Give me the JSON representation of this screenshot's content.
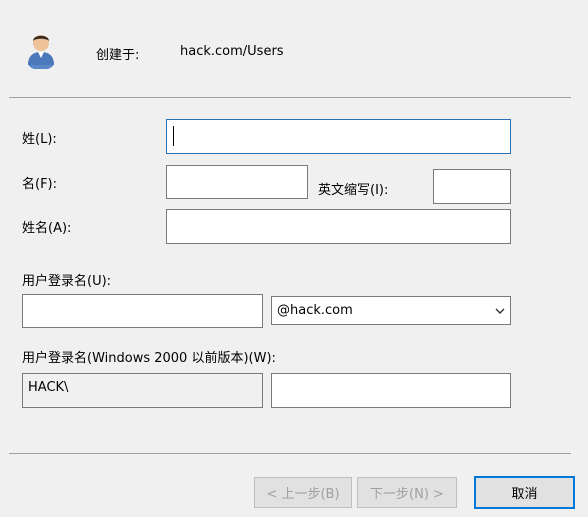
{
  "header": {
    "created_in_label": "创建于:",
    "created_in_value": "hack.com/Users"
  },
  "form": {
    "last_name_label": "姓(L):",
    "last_name_value": "",
    "first_name_label": "名(F):",
    "first_name_value": "",
    "initials_label": "英文缩写(I):",
    "initials_value": "",
    "full_name_label": "姓名(A):",
    "full_name_value": "",
    "logon_name_label": "用户登录名(U):",
    "logon_name_value": "",
    "domain_selected": "@hack.com",
    "prewin2000_label": "用户登录名(Windows 2000 以前版本)(W):",
    "prewin2000_domain": "HACK\\",
    "prewin2000_value": ""
  },
  "buttons": {
    "back_label": "< 上一步(B)",
    "next_label": "下一步(N) >",
    "cancel_label": "取消"
  },
  "icons": {
    "user": "user-icon",
    "dropdown": "chevron-down-icon"
  }
}
